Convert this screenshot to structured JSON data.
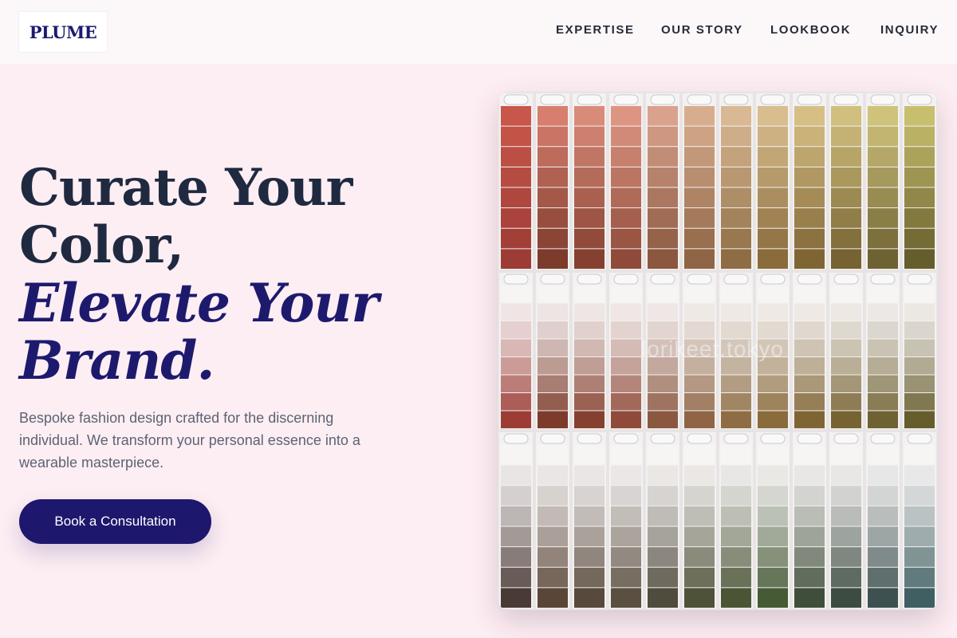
{
  "brand": {
    "logo_text": "PLUME"
  },
  "nav": {
    "items": [
      {
        "label": "EXPERTISE"
      },
      {
        "label": "OUR STORY"
      },
      {
        "label": "LOOKBOOK"
      },
      {
        "label": "INQUIRY"
      }
    ]
  },
  "hero": {
    "headline_line1": "Curate Your",
    "headline_line2": "Color,",
    "headline_italic1": "Elevate Your",
    "headline_italic2": "Brand.",
    "description": "Bespoke fashion design crafted for the discerning individual. We transform your personal essence into a wearable masterpiece.",
    "cta_label": "Book a Consultation"
  },
  "image": {
    "watermark": "lorikeet.tokyo",
    "swatch_columns": [
      {
        "top": "#c9564a",
        "bottom": "#9c3c35"
      },
      {
        "top": "#d77e6e",
        "bottom": "#7d3b2c"
      },
      {
        "top": "#d98b7a",
        "bottom": "#86402f"
      },
      {
        "top": "#dd9582",
        "bottom": "#8f4a39"
      },
      {
        "top": "#d9a28c",
        "bottom": "#8a573f"
      },
      {
        "top": "#d8ad8e",
        "bottom": "#8f6545"
      },
      {
        "top": "#d9b993",
        "bottom": "#8e6d44"
      },
      {
        "top": "#d8bd8e",
        "bottom": "#8a6b3b"
      },
      {
        "top": "#d6bf85",
        "bottom": "#806534"
      },
      {
        "top": "#d0bf7e",
        "bottom": "#776331"
      },
      {
        "top": "#cfc37c",
        "bottom": "#6f6232"
      },
      {
        "top": "#c8bf6e",
        "bottom": "#665d2c"
      }
    ],
    "row_tints": [
      {
        "top": "#ffffff",
        "mid": "#e9e2e2",
        "bottom": "#5a4a40"
      }
    ],
    "bottom_row_columns": [
      {
        "top": "#ece6e6",
        "bottom": "#4a3a35"
      },
      {
        "top": "#ece5e3",
        "bottom": "#5a4638"
      },
      {
        "top": "#ebe6e2",
        "bottom": "#57493c"
      },
      {
        "top": "#e9e6e1",
        "bottom": "#5a4f40"
      },
      {
        "top": "#e6e4dd",
        "bottom": "#4f4b3d"
      },
      {
        "top": "#e5e5dc",
        "bottom": "#4e5238"
      },
      {
        "top": "#e3e5db",
        "bottom": "#4a5535"
      },
      {
        "top": "#e1e6da",
        "bottom": "#465a36"
      },
      {
        "top": "#e1e5dc",
        "bottom": "#3f4e3a"
      },
      {
        "top": "#dfe5de",
        "bottom": "#3c4c42"
      },
      {
        "top": "#dde5e2",
        "bottom": "#3d5250"
      },
      {
        "top": "#dae6e8",
        "bottom": "#3f5f63"
      }
    ]
  }
}
